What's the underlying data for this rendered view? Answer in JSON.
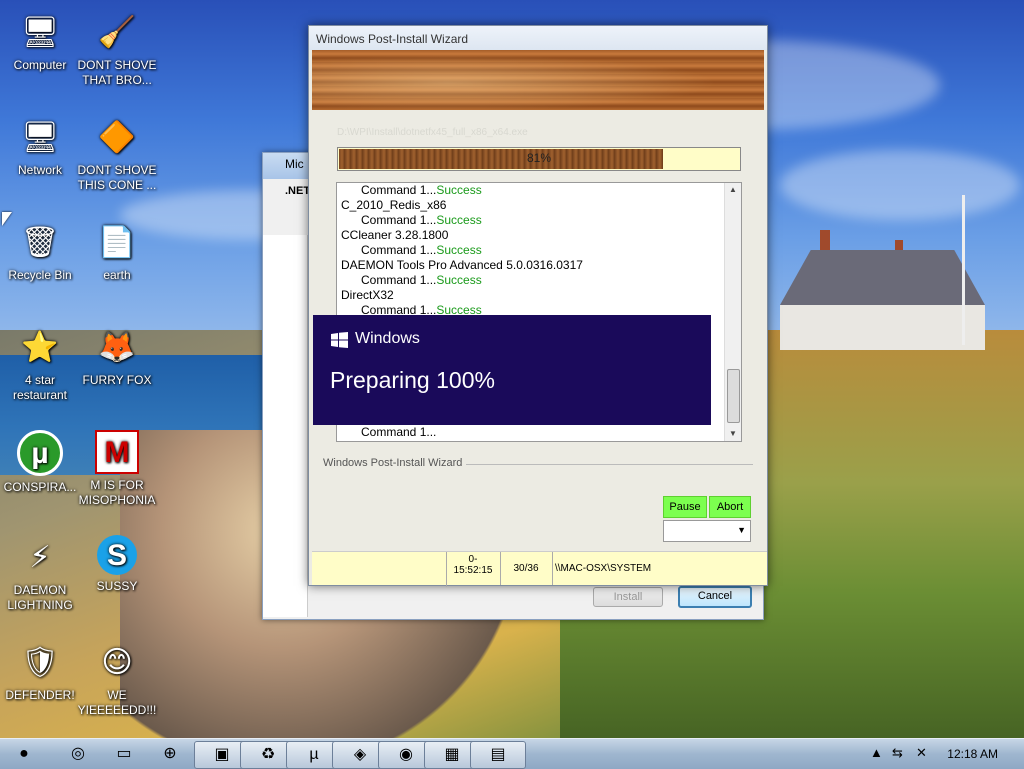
{
  "desktop": {
    "icons": [
      {
        "label": "Computer",
        "glyph": "🖥"
      },
      {
        "label": "DONT SHOVE THAT BRO...",
        "glyph": "🧹"
      },
      {
        "label": "Network",
        "glyph": "🖥"
      },
      {
        "label": "DONT SHOVE THIS CONE ...",
        "glyph": "🔶"
      },
      {
        "label": "Recycle Bin",
        "glyph": "🗑"
      },
      {
        "label": "earth",
        "glyph": "📄"
      },
      {
        "label": "4 star restaurant",
        "glyph": "⭐"
      },
      {
        "label": "FURRY FOX",
        "glyph": "🦊"
      },
      {
        "label": "CONSPIRA...",
        "glyph": "µ"
      },
      {
        "label": "M IS FOR MISOPHONIA",
        "glyph": "M"
      },
      {
        "label": "DAEMON LIGHTNING",
        "glyph": "⚡"
      },
      {
        "label": "SUSSY",
        "glyph": "S"
      },
      {
        "label": "DEFENDER!",
        "glyph": "🛡"
      },
      {
        "label": "WE YIEEEEEDD!!!",
        "glyph": "😊"
      }
    ]
  },
  "bg_dialog": {
    "title": "Mic",
    "net_label": ".NET",
    "install_label": "Install",
    "cancel_label": "Cancel"
  },
  "wizard": {
    "title": "Windows Post-Install Wizard",
    "current_path": "D:\\WPI\\Install\\dotnetfx45_full_x86_x64.exe",
    "progress_text": "81%",
    "progress_value": 0.81,
    "log": [
      {
        "text": "Command 1...",
        "status": "Success",
        "indent": true
      },
      {
        "text": "C_2010_Redis_x86",
        "status": "",
        "indent": false
      },
      {
        "text": "Command 1...",
        "status": "Success",
        "indent": true
      },
      {
        "text": "CCleaner 3.28.1800",
        "status": "",
        "indent": false
      },
      {
        "text": "Command 1...",
        "status": "Success",
        "indent": true
      },
      {
        "text": "DAEMON Tools Pro Advanced 5.0.0316.0317",
        "status": "",
        "indent": false
      },
      {
        "text": "Command 1...",
        "status": "Success",
        "indent": true
      },
      {
        "text": "DirectX32",
        "status": "",
        "indent": false
      },
      {
        "text": "Command 1...",
        "status": "Success",
        "indent": true
      }
    ],
    "log_last": "Command 1...",
    "group_label": "Windows Post-Install Wizard",
    "pause_label": "Pause",
    "abort_label": "Abort",
    "status": {
      "time_line1": "0-",
      "time_line2": "15:52:15",
      "count": "30/36",
      "machine": "\\\\MAC-OSX\\SYSTEM"
    }
  },
  "overlay": {
    "brand": "Windows",
    "message": "Preparing 100%"
  },
  "taskbar": {
    "clock": "12:18 AM"
  }
}
